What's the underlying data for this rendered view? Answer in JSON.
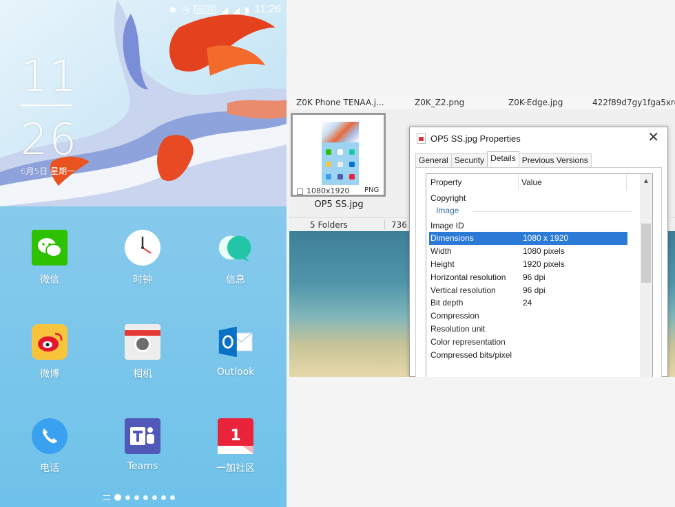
{
  "phone": {
    "status": {
      "time": "11:26",
      "lte": "VoLTE"
    },
    "clock": {
      "hour": "11",
      "minute": "26",
      "date": "6月5日 星期一"
    },
    "apps": [
      {
        "label": "微信",
        "icon": "wechat-icon",
        "color": "#2dc100"
      },
      {
        "label": "时钟",
        "icon": "clock-icon",
        "color": "#ffffff"
      },
      {
        "label": "信息",
        "icon": "messages-icon",
        "color": "#2dd4b0"
      },
      {
        "label": "微博",
        "icon": "weibo-icon",
        "color": "#f7c43c"
      },
      {
        "label": "相机",
        "icon": "camera-icon",
        "color": "#eeeeee"
      },
      {
        "label": "Outlook",
        "icon": "outlook-icon",
        "color": "#0a72c6"
      },
      {
        "label": "电话",
        "icon": "phone-icon",
        "color": "#3aa1f0"
      },
      {
        "label": "Teams",
        "icon": "teams-icon",
        "color": "#5058b8"
      },
      {
        "label": "一加社区",
        "icon": "oneplus-community-icon",
        "color": "#e8233a"
      }
    ]
  },
  "explorer": {
    "file_names": [
      "Z0K Phone TENAA.j...",
      "Z0K_Z2.png",
      "Z0K-Edge.jpg",
      "422f89d7gy1fga5xre..."
    ],
    "thumbnail": {
      "dimensions": "1080x1920",
      "type": "PNG",
      "name": "OP5 SS.jpg"
    },
    "statusbar": {
      "folders": "5 Folders",
      "items": "736 I"
    }
  },
  "dialog": {
    "title": "OP5 SS.jpg Properties",
    "tabs": [
      "General",
      "Security",
      "Details",
      "Previous Versions"
    ],
    "active_tab": "Details",
    "columns": {
      "property": "Property",
      "value": "Value"
    },
    "pre_rows": [
      {
        "property": "Copyright",
        "value": ""
      }
    ],
    "group": "Image",
    "rows": [
      {
        "property": "Image ID",
        "value": ""
      },
      {
        "property": "Dimensions",
        "value": "1080 x 1920"
      },
      {
        "property": "Width",
        "value": "1080 pixels"
      },
      {
        "property": "Height",
        "value": "1920 pixels"
      },
      {
        "property": "Horizontal resolution",
        "value": "96 dpi"
      },
      {
        "property": "Vertical resolution",
        "value": "96 dpi"
      },
      {
        "property": "Bit depth",
        "value": "24"
      },
      {
        "property": "Compression",
        "value": ""
      },
      {
        "property": "Resolution unit",
        "value": ""
      },
      {
        "property": "Color representation",
        "value": ""
      },
      {
        "property": "Compressed bits/pixel",
        "value": ""
      }
    ],
    "selected_row": "Dimensions",
    "selection_color": "#2b7bd6"
  }
}
